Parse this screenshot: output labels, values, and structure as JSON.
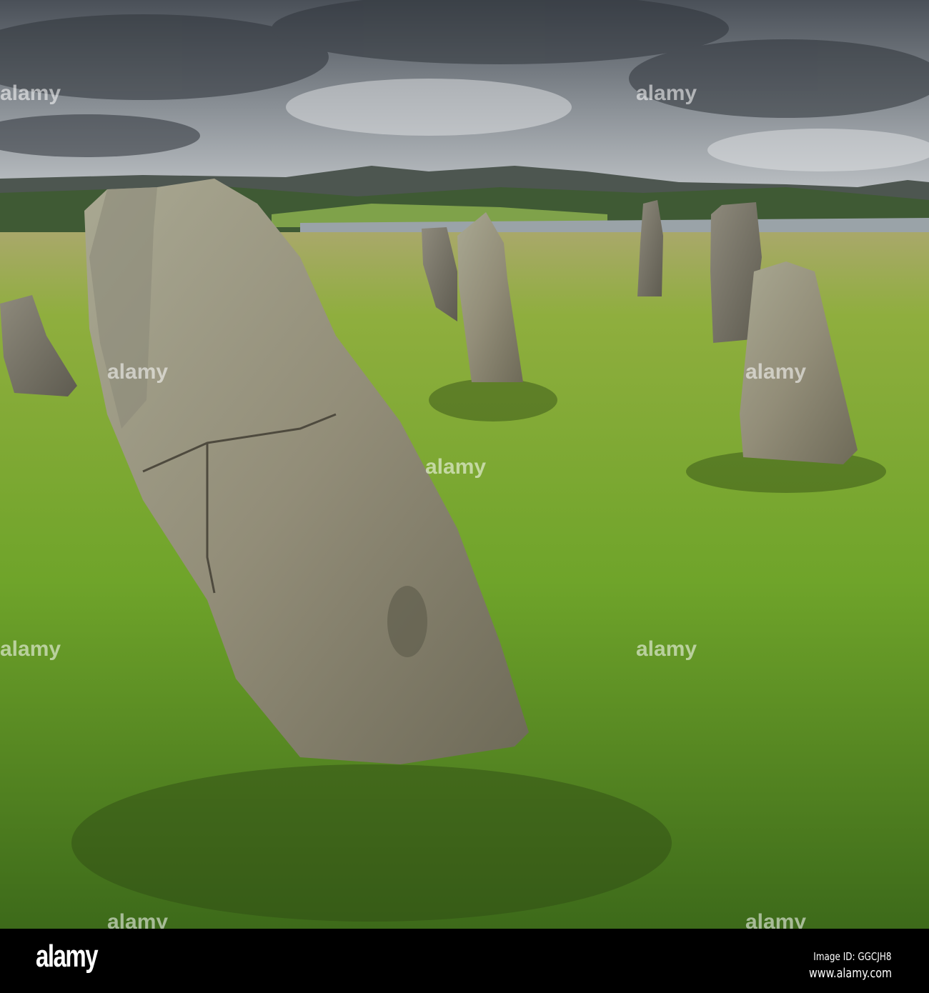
{
  "watermark": {
    "text": "alamy"
  },
  "footer": {
    "logo": "alamy",
    "image_id": "Image ID: GGCJH8",
    "url": "www.alamy.com"
  }
}
